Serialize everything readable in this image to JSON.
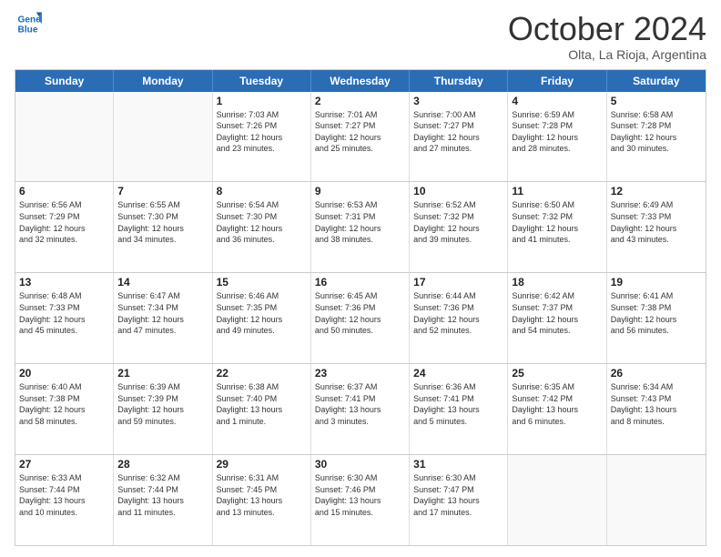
{
  "header": {
    "logo_line1": "General",
    "logo_line2": "Blue",
    "month": "October 2024",
    "location": "Olta, La Rioja, Argentina"
  },
  "weekdays": [
    "Sunday",
    "Monday",
    "Tuesday",
    "Wednesday",
    "Thursday",
    "Friday",
    "Saturday"
  ],
  "weeks": [
    [
      {
        "day": "",
        "info": ""
      },
      {
        "day": "",
        "info": ""
      },
      {
        "day": "1",
        "info": "Sunrise: 7:03 AM\nSunset: 7:26 PM\nDaylight: 12 hours\nand 23 minutes."
      },
      {
        "day": "2",
        "info": "Sunrise: 7:01 AM\nSunset: 7:27 PM\nDaylight: 12 hours\nand 25 minutes."
      },
      {
        "day": "3",
        "info": "Sunrise: 7:00 AM\nSunset: 7:27 PM\nDaylight: 12 hours\nand 27 minutes."
      },
      {
        "day": "4",
        "info": "Sunrise: 6:59 AM\nSunset: 7:28 PM\nDaylight: 12 hours\nand 28 minutes."
      },
      {
        "day": "5",
        "info": "Sunrise: 6:58 AM\nSunset: 7:28 PM\nDaylight: 12 hours\nand 30 minutes."
      }
    ],
    [
      {
        "day": "6",
        "info": "Sunrise: 6:56 AM\nSunset: 7:29 PM\nDaylight: 12 hours\nand 32 minutes."
      },
      {
        "day": "7",
        "info": "Sunrise: 6:55 AM\nSunset: 7:30 PM\nDaylight: 12 hours\nand 34 minutes."
      },
      {
        "day": "8",
        "info": "Sunrise: 6:54 AM\nSunset: 7:30 PM\nDaylight: 12 hours\nand 36 minutes."
      },
      {
        "day": "9",
        "info": "Sunrise: 6:53 AM\nSunset: 7:31 PM\nDaylight: 12 hours\nand 38 minutes."
      },
      {
        "day": "10",
        "info": "Sunrise: 6:52 AM\nSunset: 7:32 PM\nDaylight: 12 hours\nand 39 minutes."
      },
      {
        "day": "11",
        "info": "Sunrise: 6:50 AM\nSunset: 7:32 PM\nDaylight: 12 hours\nand 41 minutes."
      },
      {
        "day": "12",
        "info": "Sunrise: 6:49 AM\nSunset: 7:33 PM\nDaylight: 12 hours\nand 43 minutes."
      }
    ],
    [
      {
        "day": "13",
        "info": "Sunrise: 6:48 AM\nSunset: 7:33 PM\nDaylight: 12 hours\nand 45 minutes."
      },
      {
        "day": "14",
        "info": "Sunrise: 6:47 AM\nSunset: 7:34 PM\nDaylight: 12 hours\nand 47 minutes."
      },
      {
        "day": "15",
        "info": "Sunrise: 6:46 AM\nSunset: 7:35 PM\nDaylight: 12 hours\nand 49 minutes."
      },
      {
        "day": "16",
        "info": "Sunrise: 6:45 AM\nSunset: 7:36 PM\nDaylight: 12 hours\nand 50 minutes."
      },
      {
        "day": "17",
        "info": "Sunrise: 6:44 AM\nSunset: 7:36 PM\nDaylight: 12 hours\nand 52 minutes."
      },
      {
        "day": "18",
        "info": "Sunrise: 6:42 AM\nSunset: 7:37 PM\nDaylight: 12 hours\nand 54 minutes."
      },
      {
        "day": "19",
        "info": "Sunrise: 6:41 AM\nSunset: 7:38 PM\nDaylight: 12 hours\nand 56 minutes."
      }
    ],
    [
      {
        "day": "20",
        "info": "Sunrise: 6:40 AM\nSunset: 7:38 PM\nDaylight: 12 hours\nand 58 minutes."
      },
      {
        "day": "21",
        "info": "Sunrise: 6:39 AM\nSunset: 7:39 PM\nDaylight: 12 hours\nand 59 minutes."
      },
      {
        "day": "22",
        "info": "Sunrise: 6:38 AM\nSunset: 7:40 PM\nDaylight: 13 hours\nand 1 minute."
      },
      {
        "day": "23",
        "info": "Sunrise: 6:37 AM\nSunset: 7:41 PM\nDaylight: 13 hours\nand 3 minutes."
      },
      {
        "day": "24",
        "info": "Sunrise: 6:36 AM\nSunset: 7:41 PM\nDaylight: 13 hours\nand 5 minutes."
      },
      {
        "day": "25",
        "info": "Sunrise: 6:35 AM\nSunset: 7:42 PM\nDaylight: 13 hours\nand 6 minutes."
      },
      {
        "day": "26",
        "info": "Sunrise: 6:34 AM\nSunset: 7:43 PM\nDaylight: 13 hours\nand 8 minutes."
      }
    ],
    [
      {
        "day": "27",
        "info": "Sunrise: 6:33 AM\nSunset: 7:44 PM\nDaylight: 13 hours\nand 10 minutes."
      },
      {
        "day": "28",
        "info": "Sunrise: 6:32 AM\nSunset: 7:44 PM\nDaylight: 13 hours\nand 11 minutes."
      },
      {
        "day": "29",
        "info": "Sunrise: 6:31 AM\nSunset: 7:45 PM\nDaylight: 13 hours\nand 13 minutes."
      },
      {
        "day": "30",
        "info": "Sunrise: 6:30 AM\nSunset: 7:46 PM\nDaylight: 13 hours\nand 15 minutes."
      },
      {
        "day": "31",
        "info": "Sunrise: 6:30 AM\nSunset: 7:47 PM\nDaylight: 13 hours\nand 17 minutes."
      },
      {
        "day": "",
        "info": ""
      },
      {
        "day": "",
        "info": ""
      }
    ]
  ]
}
